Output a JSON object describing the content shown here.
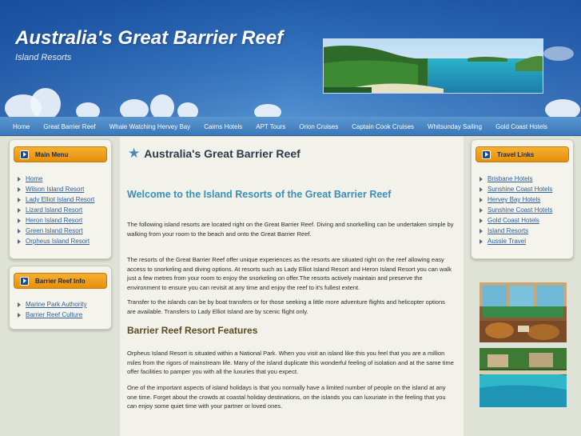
{
  "header": {
    "title": "Australia's Great Barrier Reef",
    "subtitle": "Island Resorts"
  },
  "nav": {
    "items": [
      "Home",
      "Great Barrier Reef",
      "Whale Watching Hervey Bay",
      "Cairns Hotels",
      "APT Tours",
      "Orion Cruises",
      "Captain Cook Cruises",
      "Whitsunday Sailing",
      "Gold Coast Hotels"
    ]
  },
  "sidebar_left": {
    "main_menu": {
      "title": "Main Menu",
      "items": [
        "Home",
        "Wilson Island Resort",
        "Lady Elliot Island Resort",
        "Lizard Island Resort",
        "Heron Island Resort",
        "Green Island Resort",
        "Orpheus Island Resort"
      ]
    },
    "reef_info": {
      "title": "Barrier Reef Info",
      "items": [
        "Marine Park Authority",
        "Barrier Reef Culture"
      ]
    }
  },
  "sidebar_right": {
    "travel_links": {
      "title": "Travel Links",
      "items": [
        "Brisbane Hotels",
        "Sunshine Coast Hotels",
        "Hervey Bay Hotels",
        "Sunshine Coast Hotels",
        "Gold Coast Hotels",
        "Island Resorts",
        "Aussie Travel"
      ]
    }
  },
  "main": {
    "title": "Australia's Great Barrier Reef",
    "welcome": "Welcome to the Island Resorts of the Great Barrier Reef",
    "p1": "The following island resorts are located right on the Great Barrier Reef. Diving and snorkelling can be undertaken simple by walking from your room to the beach and onto the Great Barrier Reef.",
    "p2": "The resorts of the Great Barrier Reef offer unique experiences as the resorts are situated right on the reef allowing easy access to snorkeling and diving options. At resorts such as Lady Elliot Island Resort and Heron Island Resort you can walk just a few metres from your room to enjoy the snorkeling on offer.The resorts actively maintain and preserve the environment to ensure you can revisit at any time and enjoy the reef to it's fullest extent.",
    "p3": "Transfer to the islands can be by boat transfers or for those seeking a little more adventure flights and helicopter options are available. Transfers to Lady Elliot Island are by scenic flight only.",
    "features_heading": "Barrier Reef Resort Features",
    "p4": "Orpheus Island Resort is situated within a National Park. When you visit an island like this you feel that you are a million miles from the rigors of mainstream life.   Many of the island duplicate this wonderful feeling of isolation and at the same time offer facilities to pamper you with all the luxuries that you expect.",
    "p5": "One of the important aspects of island holidays is that you normally have a limited number of people on the island at any one time. Forget about the crowds at coastal holiday destinations, on the islands you can luxuriate in the feeling that you can enjoy some quiet time with your partner or loved ones."
  },
  "colors": {
    "header_blue": "#2f6db8",
    "nav_blue": "#4a87c4",
    "accent_orange": "#f0a020",
    "link_blue": "#2f5e9b",
    "heading_teal": "#3a8fb5"
  }
}
